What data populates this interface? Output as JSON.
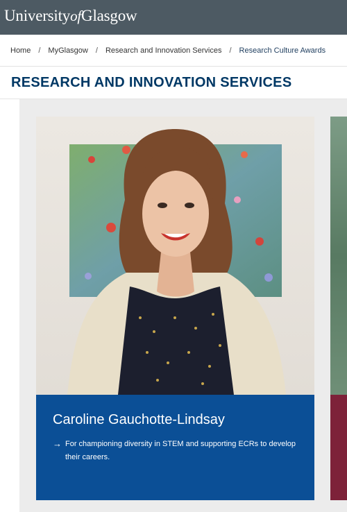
{
  "brand": {
    "logo_pre": "University",
    "logo_of": "of",
    "logo_post": "Glasgow"
  },
  "breadcrumb": [
    {
      "label": "Home"
    },
    {
      "label": "MyGlasgow"
    },
    {
      "label": "Research and Innovation Services"
    },
    {
      "label": "Research Culture Awards"
    }
  ],
  "breadcrumb_separator": "/",
  "section": {
    "title": "RESEARCH AND INNOVATION SERVICES"
  },
  "cards": [
    {
      "name": "Caroline Gauchotte-Lindsay",
      "arrow": "→",
      "description": "For championing diversity in STEM and supporting ECRs to develop their careers."
    }
  ],
  "colors": {
    "brand_bar": "#4d5a63",
    "heading": "#003865",
    "card_blue": "#0b4f96",
    "next_card_maroon": "#7d2239",
    "panel_grey": "#ececec"
  }
}
